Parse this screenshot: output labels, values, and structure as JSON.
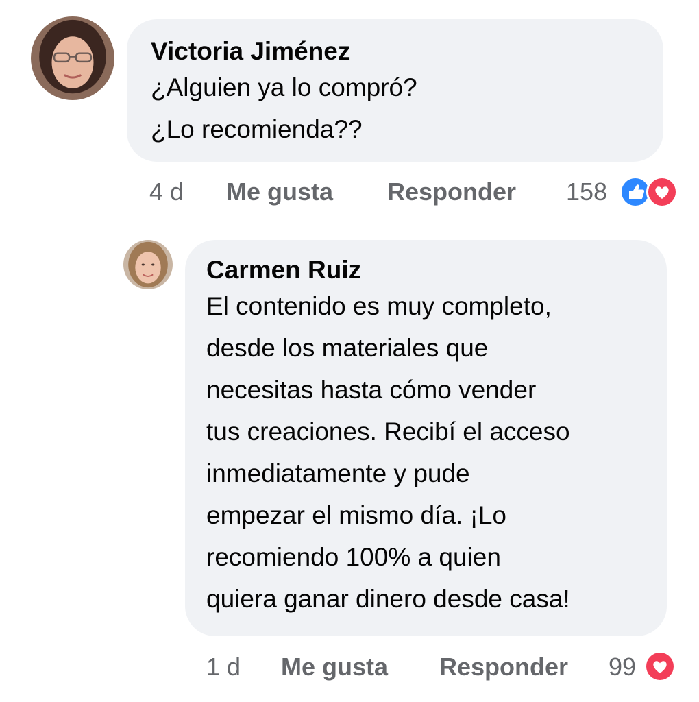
{
  "comments": [
    {
      "author": "Victoria Jiménez",
      "lines": [
        "¿Alguien ya lo compró?",
        "¿Lo recomienda??"
      ],
      "time": "4 d",
      "like_label": "Me gusta",
      "reply_label": "Responder",
      "reaction_count": "158",
      "reactions": [
        "like-icon",
        "love-icon"
      ]
    },
    {
      "author": "Carmen Ruiz",
      "lines": [
        "El contenido es muy completo,",
        "desde los materiales que",
        "necesitas hasta cómo vender",
        "tus creaciones. Recibí el acceso",
        "inmediatamente y pude",
        "empezar el mismo día. ¡Lo",
        "recomiendo 100% a quien",
        "quiera ganar dinero desde casa!"
      ],
      "time": "1 d",
      "like_label": "Me gusta",
      "reply_label": "Responder",
      "reaction_count": "99",
      "reactions": [
        "love-icon"
      ]
    }
  ],
  "colors": {
    "bubble": "#f0f2f5",
    "meta_text": "#65676b",
    "like": "#2d88ff",
    "love": "#f33e58"
  }
}
